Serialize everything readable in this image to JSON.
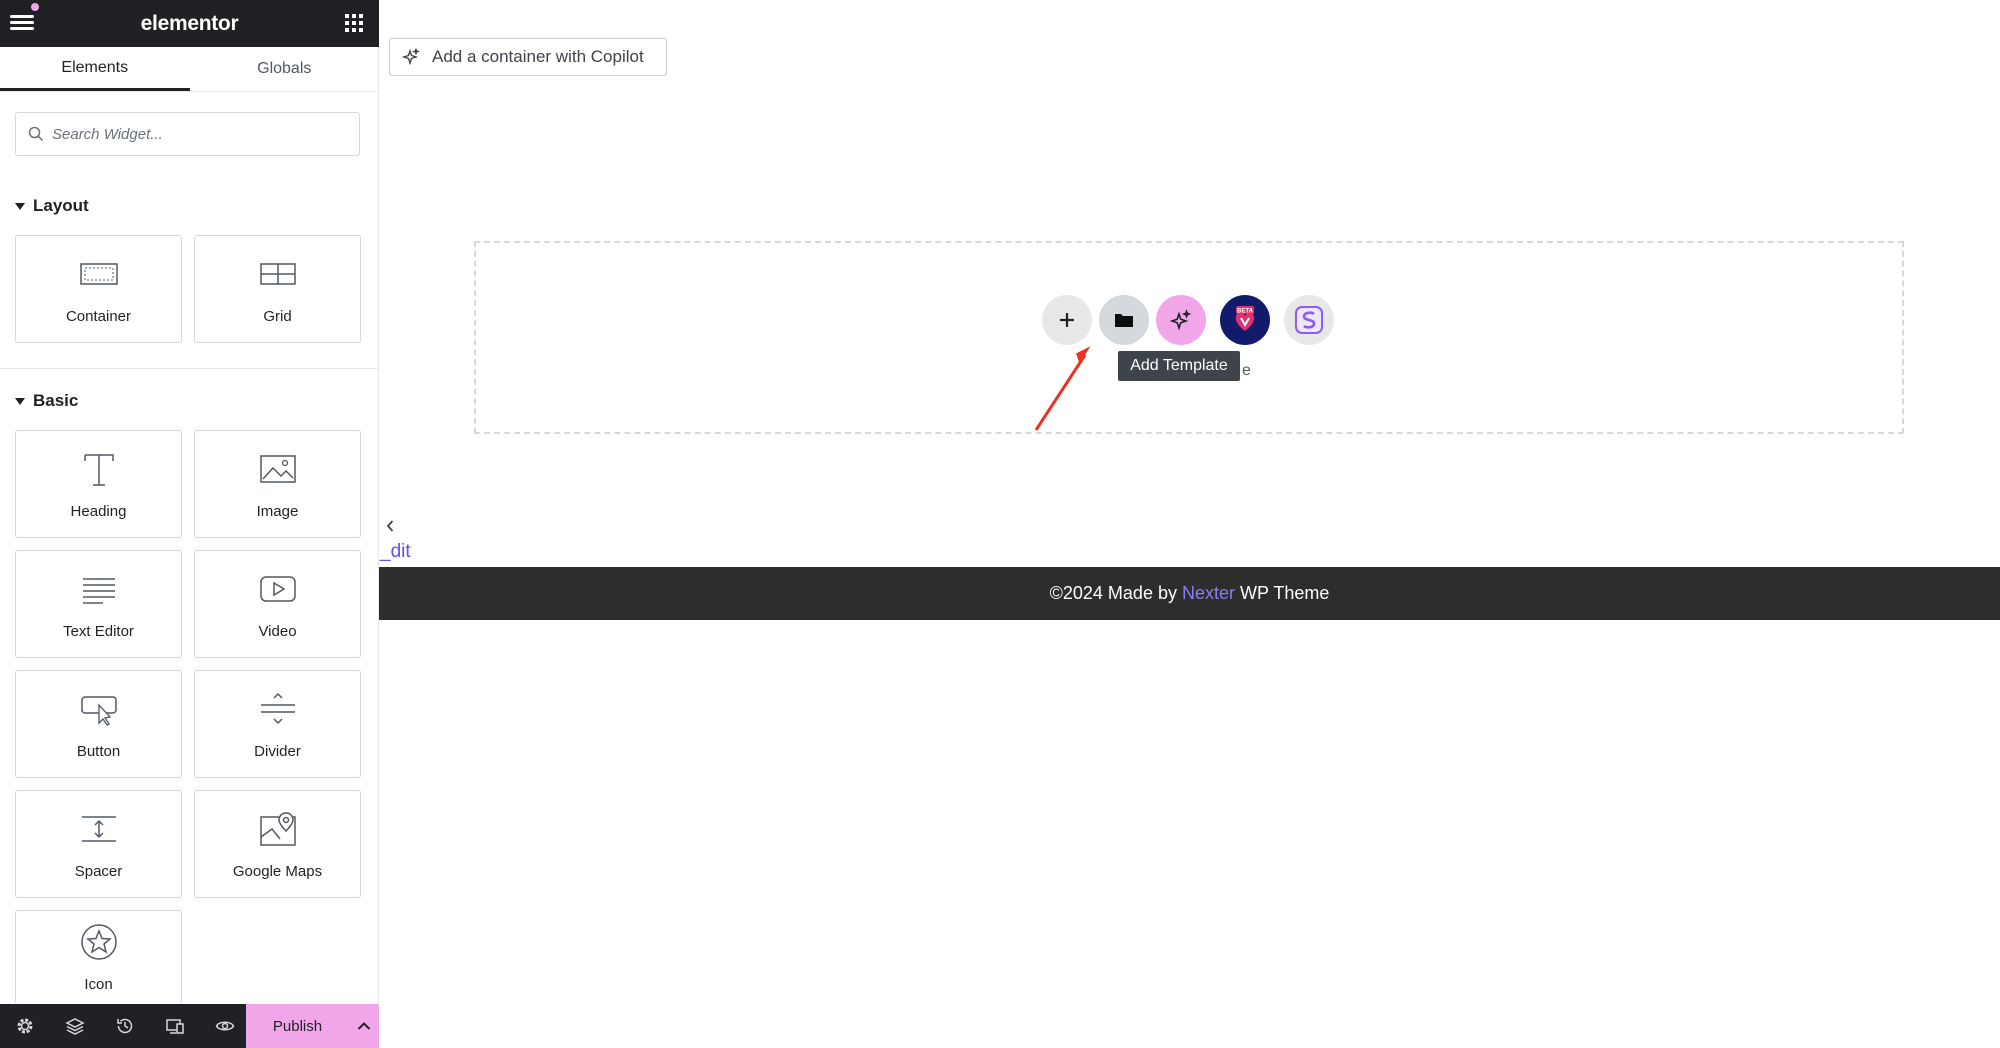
{
  "topbar": {
    "logo": "elementor"
  },
  "tabs": [
    {
      "label": "Elements"
    },
    {
      "label": "Globals"
    }
  ],
  "search": {
    "placeholder": "Search Widget..."
  },
  "sections": {
    "layout": {
      "title": "Layout",
      "items": [
        {
          "label": "Container",
          "icon": "container-icon"
        },
        {
          "label": "Grid",
          "icon": "grid-icon"
        }
      ]
    },
    "basic": {
      "title": "Basic",
      "items": [
        {
          "label": "Heading",
          "icon": "heading-icon"
        },
        {
          "label": "Image",
          "icon": "image-icon"
        },
        {
          "label": "Text Editor",
          "icon": "text-editor-icon"
        },
        {
          "label": "Video",
          "icon": "video-icon"
        },
        {
          "label": "Button",
          "icon": "button-icon"
        },
        {
          "label": "Divider",
          "icon": "divider-icon"
        },
        {
          "label": "Spacer",
          "icon": "spacer-icon"
        },
        {
          "label": "Google Maps",
          "icon": "google-maps-icon"
        },
        {
          "label": "Icon",
          "icon": "star-icon"
        }
      ]
    }
  },
  "bottombar": {
    "publish_label": "Publish"
  },
  "canvas": {
    "copilot_label": "Add a container with Copilot",
    "tooltip": "Add Template",
    "behind_text": "e",
    "beta_badge": "BETA",
    "edit_link": "_dit",
    "footer": {
      "prefix": "©2024 Made by",
      "link": "Nexter",
      "suffix": "WP Theme"
    }
  },
  "colors": {
    "accent_pink": "#f0a6e8",
    "dark": "#1f2124",
    "footer_bg": "#2d2d2d",
    "link": "#8b7cf6",
    "arrow": "#e8321f"
  }
}
